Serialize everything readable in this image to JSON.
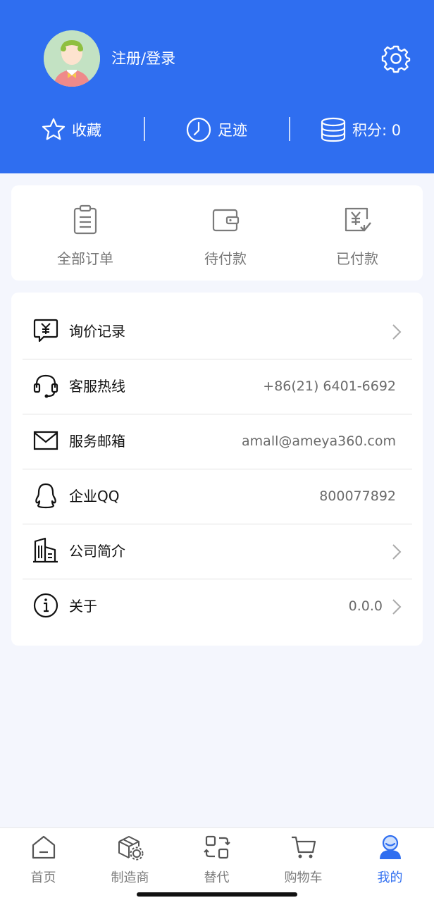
{
  "header": {
    "login_label": "注册/登录",
    "stats": [
      {
        "icon": "star-icon",
        "label": "收藏"
      },
      {
        "icon": "clock-icon",
        "label": "足迹"
      },
      {
        "icon": "coins-icon",
        "label": "积分: 0"
      }
    ]
  },
  "orders": [
    {
      "icon": "clipboard-icon",
      "label": "全部订单"
    },
    {
      "icon": "wallet-icon",
      "label": "待付款"
    },
    {
      "icon": "paid-icon",
      "label": "已付款"
    }
  ],
  "menu": [
    {
      "icon": "inquiry-icon",
      "title": "询价记录",
      "value": "",
      "arrow": true
    },
    {
      "icon": "headset-icon",
      "title": "客服热线",
      "value": "+86(21) 6401-6692",
      "arrow": false
    },
    {
      "icon": "mail-icon",
      "title": "服务邮箱",
      "value": "amall@ameya360.com",
      "arrow": false
    },
    {
      "icon": "qq-icon",
      "title": "企业QQ",
      "value": "800077892",
      "arrow": false
    },
    {
      "icon": "building-icon",
      "title": "公司简介",
      "value": "",
      "arrow": true
    },
    {
      "icon": "info-icon",
      "title": "关于",
      "value": "0.0.0",
      "arrow": true
    }
  ],
  "tabs": [
    {
      "icon": "home-icon",
      "label": "首页",
      "active": false
    },
    {
      "icon": "manufacturer-icon",
      "label": "制造商",
      "active": false
    },
    {
      "icon": "replace-icon",
      "label": "替代",
      "active": false
    },
    {
      "icon": "cart-icon",
      "label": "购物车",
      "active": false
    },
    {
      "icon": "profile-icon",
      "label": "我的",
      "active": true
    }
  ],
  "colors": {
    "brand": "#2f6ef0",
    "page_background": "#f4f6fd",
    "active_tab": "#2f6ef0"
  }
}
